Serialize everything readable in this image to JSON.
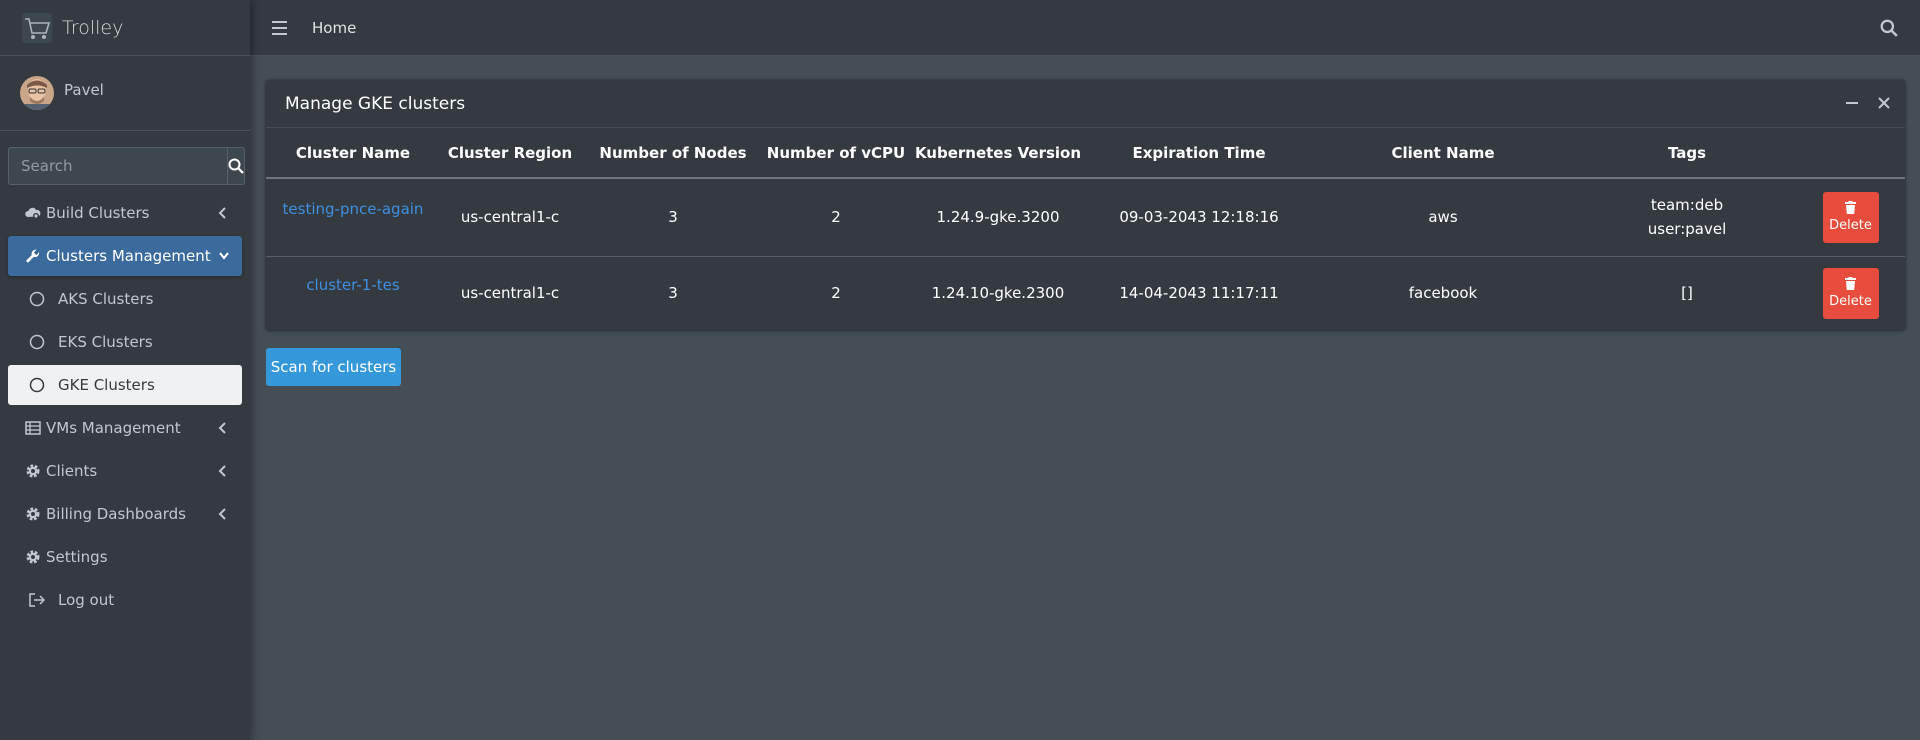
{
  "brand": {
    "name": "Trolley"
  },
  "user": {
    "name": "Pavel"
  },
  "sidebar": {
    "search_placeholder": "Search",
    "items": [
      {
        "label": "Build Clusters",
        "icon": "cloud-cog-icon",
        "has_chevron": true
      },
      {
        "label": "Clusters Management",
        "icon": "wrench-icon",
        "has_chevron": true,
        "active": true
      },
      {
        "label": "AKS Clusters",
        "icon": "circle-icon",
        "sub": true
      },
      {
        "label": "EKS Clusters",
        "icon": "circle-icon",
        "sub": true
      },
      {
        "label": "GKE Clusters",
        "icon": "circle-icon",
        "sub": true,
        "selected": true
      },
      {
        "label": "VMs Management",
        "icon": "server-icon",
        "has_chevron": true
      },
      {
        "label": "Clients",
        "icon": "gear-icon",
        "has_chevron": true
      },
      {
        "label": "Billing Dashboards",
        "icon": "gear-icon",
        "has_chevron": true
      },
      {
        "label": "Settings",
        "icon": "gear-icon"
      },
      {
        "label": "Log out",
        "icon": "logout-icon",
        "sub": true
      }
    ]
  },
  "topbar": {
    "home_label": "Home"
  },
  "card": {
    "title": "Manage GKE clusters",
    "columns": [
      "Cluster Name",
      "Cluster Region",
      "Number of Nodes",
      "Number of vCPU",
      "Kubernetes Version",
      "Expiration Time",
      "Client Name",
      "Tags"
    ],
    "rows": [
      {
        "name": "testing-pnce-again",
        "region": "us-central1-c",
        "nodes": "3",
        "vcpu": "2",
        "version": "1.24.9-gke.3200",
        "expiration": "09-03-2043 12:18:16",
        "client": "aws",
        "tags": [
          "team:deb",
          "user:pavel"
        ],
        "delete_label": "Delete"
      },
      {
        "name": "cluster-1-tes",
        "region": "us-central1-c",
        "nodes": "3",
        "vcpu": "2",
        "version": "1.24.10-gke.2300",
        "expiration": "14-04-2043 11:17:11",
        "client": "facebook",
        "tags": [
          "[]"
        ],
        "delete_label": "Delete"
      }
    ]
  },
  "scan_button": {
    "label": "Scan for clusters"
  },
  "colors": {
    "sidebar_bg": "#343a40",
    "content_bg": "#454d55",
    "active_nav": "#3b6b9d",
    "link": "#3f8fe0",
    "danger": "#e74c3c",
    "primary": "#3498db"
  }
}
